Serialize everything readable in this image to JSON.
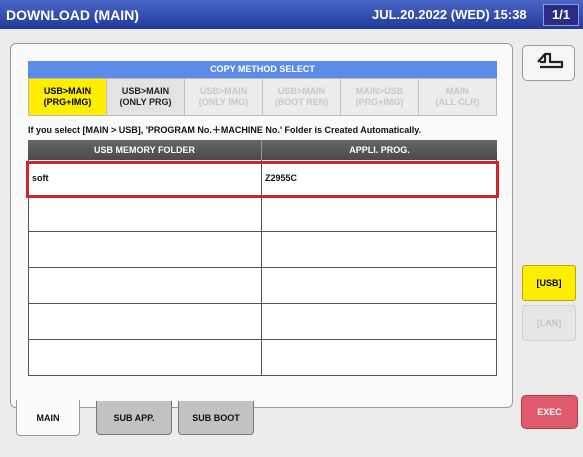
{
  "header": {
    "title": "DOWNLOAD (MAIN)",
    "datetime": "JUL.20.2022 (WED) 15:38",
    "page": "1/1"
  },
  "copy_method": {
    "title": "COPY METHOD SELECT",
    "options": [
      {
        "line1": "USB>MAIN",
        "line2": "(PRG+IMG)",
        "state": "selected"
      },
      {
        "line1": "USB>MAIN",
        "line2": "(ONLY PRG)",
        "state": "enabled"
      },
      {
        "line1": "USB>MAIN",
        "line2": "(ONLY IMG)",
        "state": "disabled"
      },
      {
        "line1": "USB>MAIN",
        "line2": "(BOOT REN)",
        "state": "disabled"
      },
      {
        "line1": "MAIN>USB",
        "line2": "(PRG+IMG)",
        "state": "disabled"
      },
      {
        "line1": "MAIN",
        "line2": "(ALL CLR)",
        "state": "disabled"
      }
    ]
  },
  "notice": "If you select [MAIN > USB], 'PROGRAM No.＋MACHINE No.' Folder is Created Automatically.",
  "table": {
    "headers": [
      "USB MEMORY FOLDER",
      "APPLI. PROG."
    ],
    "rows": [
      [
        "soft",
        "Z2955C"
      ],
      [
        "",
        ""
      ],
      [
        "",
        ""
      ],
      [
        "",
        ""
      ],
      [
        "",
        ""
      ],
      [
        "",
        ""
      ]
    ],
    "selected_row": 0
  },
  "tabs": [
    {
      "label": "MAIN",
      "active": true
    },
    {
      "label": "SUB APP.",
      "active": false
    },
    {
      "label": "SUB BOOT",
      "active": false
    }
  ],
  "side": {
    "usb_label": "[USB]",
    "lan_label": "[LAN]",
    "exec_label": "EXEC"
  },
  "icons": {
    "back": "return-arrow-icon"
  },
  "colors": {
    "titlebar": "#1f3a9a",
    "selected": "#ffee00",
    "exec": "#e05a6e",
    "highlight": "#d2232a",
    "header_bar": "#5b8de8"
  }
}
